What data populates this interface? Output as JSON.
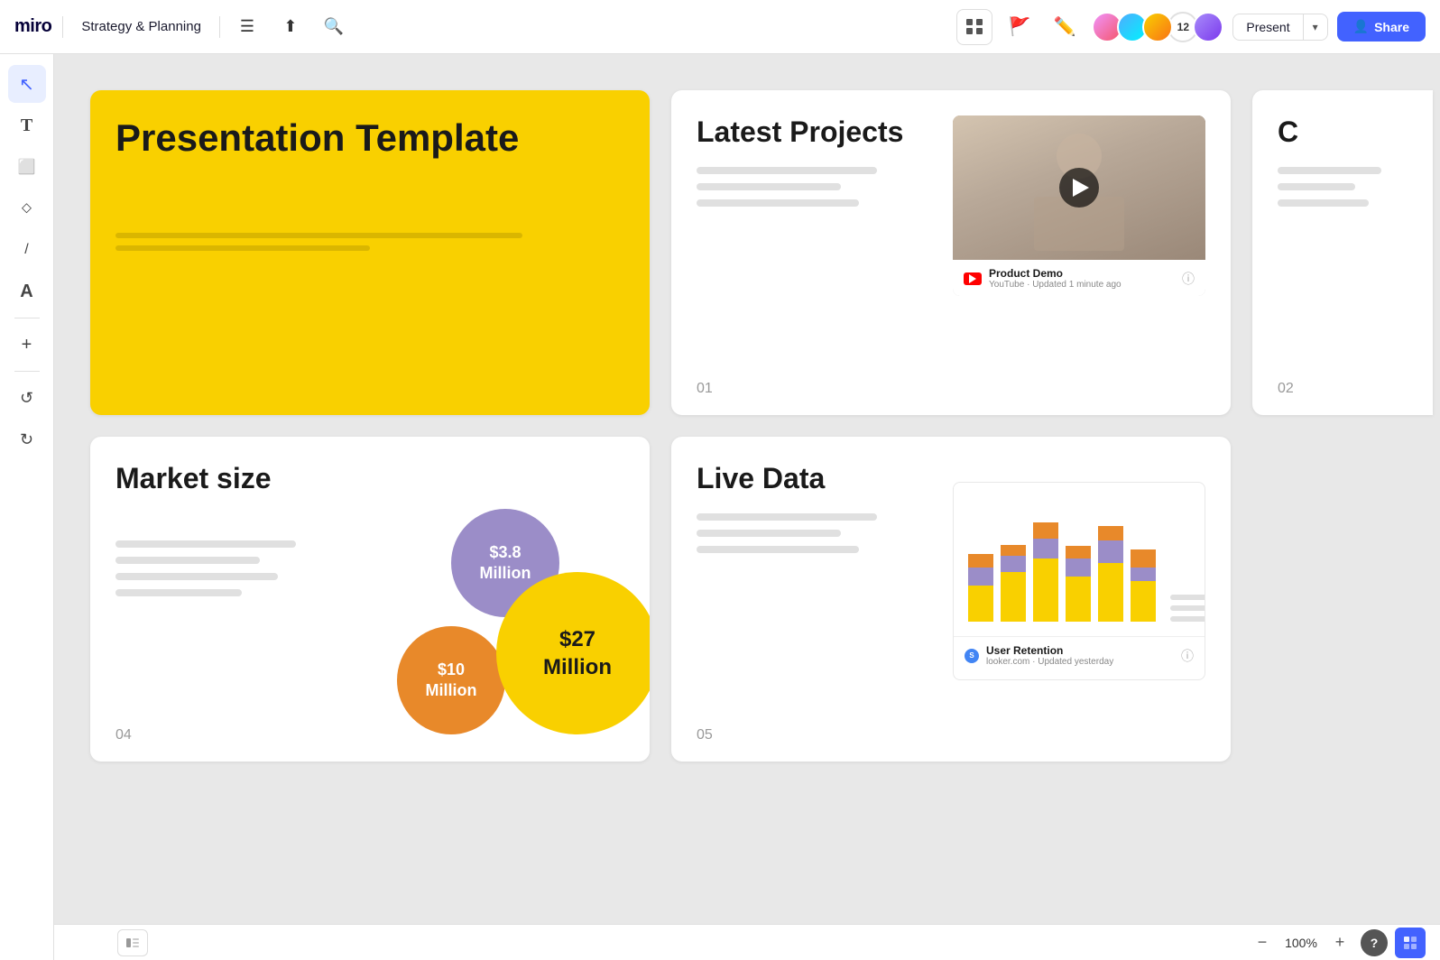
{
  "topbar": {
    "logo": "miro",
    "board_title": "Strategy & Planning",
    "present_label": "Present",
    "share_label": "Share",
    "collaborator_count": "12",
    "zoom_level": "100%"
  },
  "sidebar": {
    "tools": [
      {
        "name": "cursor",
        "icon": "↖",
        "label": "cursor-tool"
      },
      {
        "name": "text",
        "icon": "T",
        "label": "text-tool"
      },
      {
        "name": "sticky",
        "icon": "⬜",
        "label": "sticky-tool"
      },
      {
        "name": "shapes",
        "icon": "◻",
        "label": "shapes-tool"
      },
      {
        "name": "pen",
        "icon": "✏",
        "label": "pen-tool"
      },
      {
        "name": "highlight",
        "icon": "A",
        "label": "highlight-tool"
      },
      {
        "name": "add",
        "icon": "+",
        "label": "add-tool"
      },
      {
        "name": "undo",
        "icon": "↺",
        "label": "undo-tool"
      },
      {
        "name": "redo",
        "icon": "↻",
        "label": "redo-tool"
      }
    ]
  },
  "canvas": {
    "cards": {
      "presentation": {
        "title": "Presentation Template",
        "number": ""
      },
      "latest_projects": {
        "title": "Latest Projects",
        "number": "01",
        "video": {
          "title": "Product Demo",
          "source": "YouTube",
          "updated": "Updated 1 minute ago"
        }
      },
      "partial": {
        "number": "02"
      },
      "market_size": {
        "title": "Market size",
        "number": "04",
        "bubbles": [
          {
            "label": "$3.8\nMillion",
            "size": "medium",
            "color": "purple"
          },
          {
            "label": "$10\nMillion",
            "size": "medium",
            "color": "orange"
          },
          {
            "label": "$27\nMillion",
            "size": "large",
            "color": "yellow"
          }
        ]
      },
      "live_data": {
        "title": "Live Data",
        "number": "05",
        "chart": {
          "title": "User Retention",
          "source": "looker.com",
          "updated": "Updated yesterday"
        }
      }
    }
  },
  "bottombar": {
    "zoom": "100%",
    "help": "?",
    "minus": "−",
    "plus": "+"
  }
}
